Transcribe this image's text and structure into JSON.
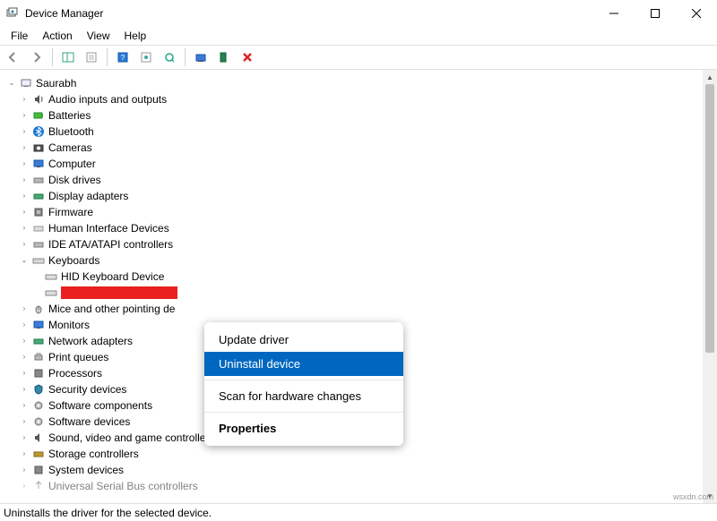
{
  "window": {
    "title": "Device Manager"
  },
  "menu": {
    "file": "File",
    "action": "Action",
    "view": "View",
    "help": "Help"
  },
  "tree": {
    "root": "Saurabh",
    "nodes": {
      "audio": "Audio inputs and outputs",
      "batteries": "Batteries",
      "bluetooth": "Bluetooth",
      "cameras": "Cameras",
      "computer": "Computer",
      "disk": "Disk drives",
      "display": "Display adapters",
      "firmware": "Firmware",
      "hid": "Human Interface Devices",
      "ide": "IDE ATA/ATAPI controllers",
      "keyboards": "Keyboards",
      "hid_kbd": "HID Keyboard Device",
      "mice": "Mice and other pointing de",
      "monitors": "Monitors",
      "network": "Network adapters",
      "printq": "Print queues",
      "processors": "Processors",
      "security": "Security devices",
      "sw_comp": "Software components",
      "sw_dev": "Software devices",
      "sound": "Sound, video and game controllers",
      "storage": "Storage controllers",
      "system": "System devices",
      "usb": "Universal Serial Bus controllers"
    }
  },
  "context_menu": {
    "update": "Update driver",
    "uninstall": "Uninstall device",
    "scan": "Scan for hardware changes",
    "properties": "Properties"
  },
  "status": "Uninstalls the driver for the selected device.",
  "watermark": "wsxdn.com"
}
